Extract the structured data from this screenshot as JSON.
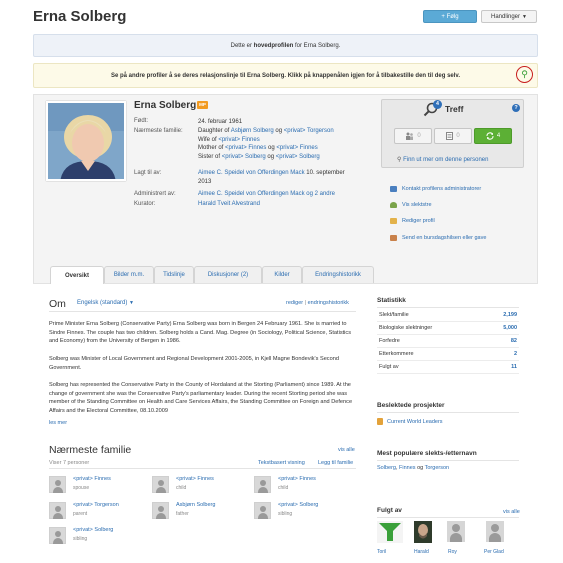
{
  "header": {
    "title": "Erna Solberg",
    "follow_label": "+ Følg",
    "actions_label": "Handlinger"
  },
  "banner": {
    "main_profile_prefix": "Dette er ",
    "main_profile_bold": "hovedprofilen",
    "main_profile_suffix": " for Erna Solberg.",
    "relation_text": "Se på andre profiler å se deres relasjonslinje til Erna Solberg. Klikk på knappenålen igjen for å tilbakestille den til deg selv."
  },
  "profile": {
    "name": "Erna Solberg",
    "badge": "MP",
    "born_label": "Født:",
    "born_value": "24. februar 1961",
    "family_label": "Nærmeste familie:",
    "family_lines": [
      [
        "Daughter of ",
        "Asbjørn Solberg",
        " og ",
        "<privat> Torgerson"
      ],
      [
        "Wife of ",
        "<privat> Finnes"
      ],
      [
        "Mother of ",
        "<privat> Finnes",
        " og ",
        "<privat> Finnes"
      ],
      [
        "Sister of ",
        "<privat> Solberg",
        " og ",
        "<privat> Solberg"
      ]
    ],
    "added_label": "Lagt til av:",
    "added_by": "Aimee C. Speidel von Offerdingen Mack",
    "added_date": " 10. september 2013",
    "managed_label": "Administrert av:",
    "managed_by": "Aimee C. Speidel von Offerdingen Mack",
    "managed_more": " og 2 andre",
    "curator_label": "Kurator:",
    "curator": "Harald Tveit Alvestrand"
  },
  "treff": {
    "count": "4",
    "title": "Treff",
    "boxes": [
      {
        "icon": "people-icon",
        "count": "0"
      },
      {
        "icon": "document-icon",
        "count": "0"
      },
      {
        "icon": "sync-icon",
        "count": "4"
      }
    ],
    "find_more": "Finn ut mer om denne personen"
  },
  "side_links": [
    {
      "icon": "contact-admin-icon",
      "label": "Kontakt profilens administratorer"
    },
    {
      "icon": "tree-icon",
      "label": "Vis slektstre"
    },
    {
      "icon": "edit-icon",
      "label": "Rediger profil"
    },
    {
      "icon": "birthday-icon",
      "label": "Send en bursdagshilsen eller gave"
    }
  ],
  "tabs": [
    "Oversikt",
    "Bilder m.m.",
    "Tidslinje",
    "Diskusjoner (2)",
    "Kilder",
    "Endringshistorikk"
  ],
  "om": {
    "title": "Om",
    "language": "Engelsk (standard)",
    "edit": "rediger",
    "separator": " | ",
    "history": "endringshistorikk",
    "paragraphs": [
      "Prime Minister Erna Solberg (Conservative Party) Erna Solberg was born in Bergen 24 February 1961. She is married to Sindre Finnes. The couple has two children. Solberg holds a Cand. Mag. Degree (in Sociology, Political Science, Statistics and Economy) from the University of Bergen in 1986.",
      "Solberg was Minister of Local Government and Regional Development 2001-2005, in Kjell Magne Bondevik's Second Government.",
      "Solberg has represented the Conservative Party in the County of Hordaland at the Storting (Parliament) since 1989. At the change of government she was the Conservative Party's parliamentary leader. During the recent Storting period she was member of the Standing Committee on Health and Care Services Affairs, the Standing Committee on Foreign and Defence Affairs and the Electoral Committee, 08.10.2009"
    ],
    "more": "les mer"
  },
  "family": {
    "title": "Nærmeste familie",
    "see_all": "vis alle",
    "shows": "Viser 7 personer",
    "text_view": "Tekstbasert visning",
    "add": "Legg til familie",
    "members": [
      {
        "name": "<privat> Finnes",
        "role": "spouse"
      },
      {
        "name": "<privat> Finnes",
        "role": "child"
      },
      {
        "name": "<privat> Finnes",
        "role": "child"
      },
      {
        "name": "<privat> Torgerson",
        "role": "parent"
      },
      {
        "name": "Asbjørn Solberg",
        "role": "father"
      },
      {
        "name": "<privat> Solberg",
        "role": "sibling"
      },
      {
        "name": "<privat> Solberg",
        "role": "sibling"
      }
    ]
  },
  "stats": {
    "title": "Statistikk",
    "rows": [
      {
        "label": "Slekt/familie",
        "value": "2,199"
      },
      {
        "label": "Biologiske slektninger",
        "value": "5,000"
      },
      {
        "label": "Forfedre",
        "value": "82"
      },
      {
        "label": "Etterkommere",
        "value": "2"
      },
      {
        "label": "Fulgt av",
        "value": "11"
      }
    ]
  },
  "projects": {
    "title": "Beslektede prosjekter",
    "item": "Current World Leaders"
  },
  "popular": {
    "title": "Mest populære slekts-/etternavn",
    "name1": "Solberg",
    "sep1": ", ",
    "name2": "Finnes",
    "sep2": " og ",
    "name3": "Torgerson"
  },
  "followers": {
    "title": "Fulgt av",
    "see_all": "vis alle",
    "people": [
      "Toril",
      "Harald",
      "Roy",
      "Per Glad"
    ]
  }
}
